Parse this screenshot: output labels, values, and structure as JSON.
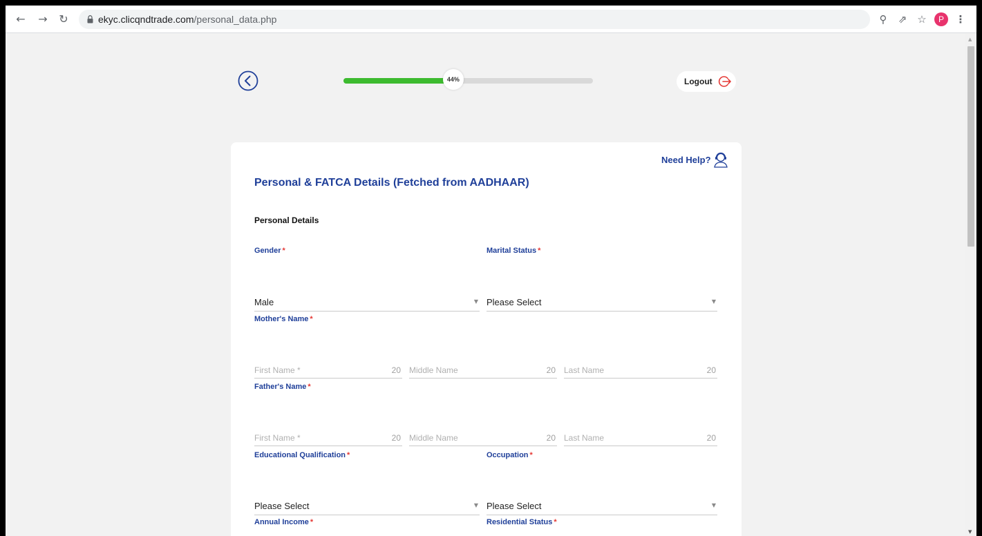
{
  "browser": {
    "url_domain": "ekyc.clicqndtrade.com",
    "url_path": "/personal_data.php",
    "profile_initial": "P"
  },
  "progress": {
    "value": 0.44,
    "label": "44%",
    "fill_color": "#3dbb2f"
  },
  "header": {
    "logout_label": "Logout"
  },
  "form": {
    "need_help_label": "Need Help?",
    "title": "Personal & FATCA Details (Fetched from AADHAAR)",
    "section_title": "Personal Details",
    "required_mark": "*",
    "gender": {
      "label": "Gender",
      "value": "Male"
    },
    "marital_status": {
      "label": "Marital Status",
      "value": "Please Select"
    },
    "mothers_name": {
      "label": "Mother's Name",
      "first": {
        "placeholder": "First Name *",
        "max": "20"
      },
      "middle": {
        "placeholder": "Middle Name",
        "max": "20"
      },
      "last": {
        "placeholder": "Last Name",
        "max": "20"
      }
    },
    "fathers_name": {
      "label": "Father's Name",
      "first": {
        "placeholder": "First Name *",
        "max": "20"
      },
      "middle": {
        "placeholder": "Middle Name",
        "max": "20"
      },
      "last": {
        "placeholder": "Last Name",
        "max": "20"
      }
    },
    "education": {
      "label": "Educational Qualification",
      "value": "Please Select"
    },
    "occupation": {
      "label": "Occupation",
      "value": "Please Select"
    },
    "annual_income": {
      "label": "Annual Income"
    },
    "residential_status": {
      "label": "Residential Status"
    }
  },
  "colors": {
    "brand_blue": "#1f3f99",
    "required_red": "#e53935",
    "logout_red": "#e53935"
  },
  "icons": {
    "back": "chevron-left-circle-icon",
    "logout": "logout-icon",
    "help": "headset-icon"
  }
}
